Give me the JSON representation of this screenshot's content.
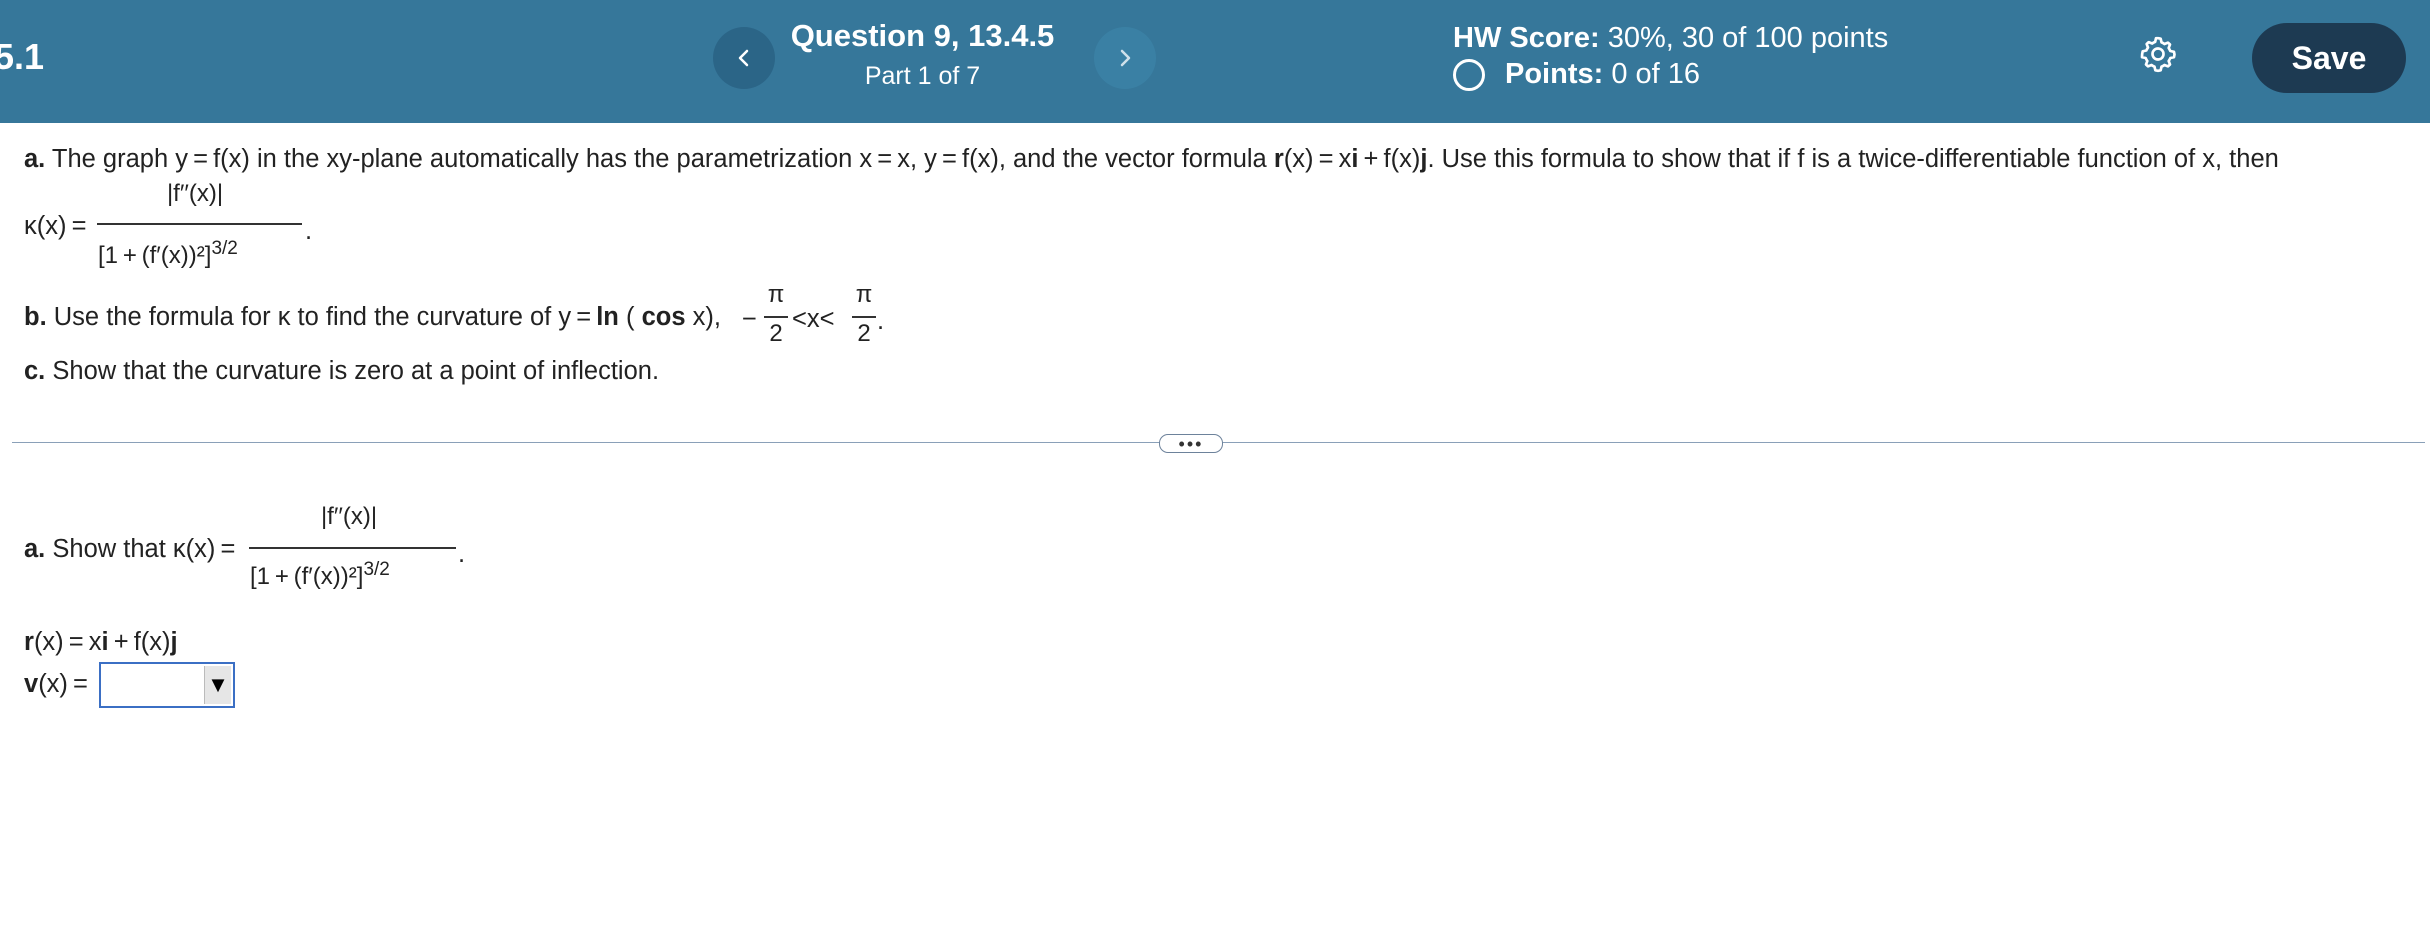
{
  "header": {
    "section_partial": "5.1",
    "question_title": "Question 9, 13.4.5",
    "part": "Part 1 of 7",
    "hw_score_label": "HW Score:",
    "hw_score_value": "30%, 30 of 100 points",
    "points_label": "Points:",
    "points_value": "0 of 16",
    "save_label": "Save"
  },
  "problem": {
    "a_label": "a.",
    "a_text_1": "The graph y = f(x) in the xy-plane automatically has the parametrization x = x, y = f(x), and the vector formula ",
    "a_r": "r",
    "a_text_2": "(x) = x",
    "a_i": "i",
    "a_text_3": " + f(x)",
    "a_j": "j",
    "a_text_4": ". Use this formula to show that if f is a twice-differentiable function of x, then",
    "kappa_lhs": "κ(x) =",
    "frac_num": "|f′′(x)|",
    "frac_den": "[1 + (f′(x))²]",
    "frac_exp": "3/2",
    "period": ".",
    "b_label": "b.",
    "b_text_1": "Use the formula for κ to find the curvature of y = ",
    "b_ln": "ln",
    "b_paren_open": "(",
    "b_cos": "cos",
    "b_text_2": "x),",
    "b_minus": "−",
    "pi": "π",
    "two": "2",
    "b_ineq": "<x<",
    "c_label": "c.",
    "c_text": "Show that the curvature is zero at a point of inflection."
  },
  "divider_dots": "•••",
  "work": {
    "a_label": "a.",
    "a_text": "Show that κ(x) =",
    "r_bold": "r",
    "r_rest_1": "(x) = x",
    "r_i": "i",
    "r_rest_2": " + f(x)",
    "r_j": "j",
    "v_bold": "v",
    "v_rest": "(x) =",
    "v_selected": ""
  },
  "colors": {
    "header_bg": "#36779a",
    "save_bg": "#1d3a52",
    "dropdown_border": "#3b6fc4"
  }
}
